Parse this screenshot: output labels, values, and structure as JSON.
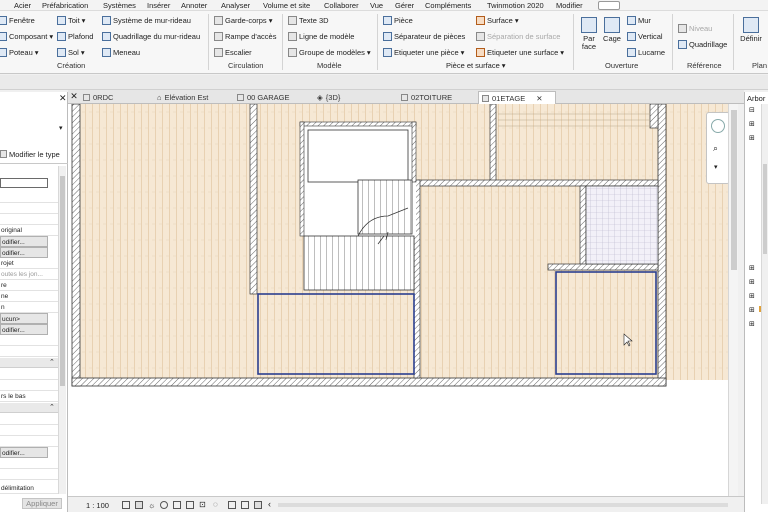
{
  "menu": [
    "Acier",
    "Préfabrication",
    "Systèmes",
    "Insérer",
    "Annoter",
    "Analyser",
    "Volume et site",
    "Collaborer",
    "Vue",
    "Gérer",
    "Compléments",
    "Twinmotion 2020",
    "Modifier"
  ],
  "ribbon": {
    "build": {
      "fenetre": "Fenêtre",
      "composant": "Composant",
      "poteau": "Poteau",
      "toit": "Toit",
      "plafond": "Plafond",
      "sol": "Sol",
      "systeme_mur_rideau": "Système de mur-rideau",
      "quadrillage_mur_rideau": "Quadrillage du mur-rideau",
      "meneau": "Meneau",
      "title": "Création"
    },
    "circulation": {
      "garde_corps": "Garde-corps",
      "rampe": "Rampe d'accès",
      "escalier": "Escalier",
      "title": "Circulation"
    },
    "model": {
      "texte3d": "Texte 3D",
      "ligne": "Ligne de modèle",
      "groupe": "Groupe de modèles",
      "title": "Modèle"
    },
    "room": {
      "piece": "Pièce",
      "separateur": "Séparateur de pièces",
      "etiquette_piece": "Etiqueter une pièce",
      "surface": "Surface",
      "separation_surface": "Séparation de surface",
      "etiquette_surface": "Etiqueter une surface",
      "title": "Pièce et surface"
    },
    "opening": {
      "par_face": "Par\nface",
      "cage": "Cage",
      "mur": "Mur",
      "vertical": "Vertical",
      "lucarne": "Lucarne",
      "title": "Ouverture"
    },
    "reference": {
      "niveau": "Niveau",
      "quadrillage": "Quadrillage",
      "title": "Référence"
    },
    "plan": {
      "definir": "Définir",
      "title": "Plan"
    }
  },
  "tabs": [
    "0RDC",
    "Elévation Est",
    "00 GARAGE",
    "{3D}",
    "02TOITURE",
    "01ETAGE"
  ],
  "active_tab": "01ETAGE",
  "properties": {
    "edit_type": "Modifier le type",
    "rows": [
      "original",
      "odifier...",
      "odifier...",
      "rojet",
      "outes les jon...",
      "re",
      "ne",
      "n",
      "ucun>",
      "odifier...",
      "rs le bas",
      "odifier...",
      "délimitation"
    ],
    "apply": "Appliquer"
  },
  "browser": {
    "title": "Arbor"
  },
  "status": {
    "scale": "1 : 100"
  },
  "colors": {
    "wood": "#f6e8d4",
    "wall_hatch": "#555555",
    "selected_room": "#2b3f8f",
    "accent": "#1c5fa8"
  }
}
